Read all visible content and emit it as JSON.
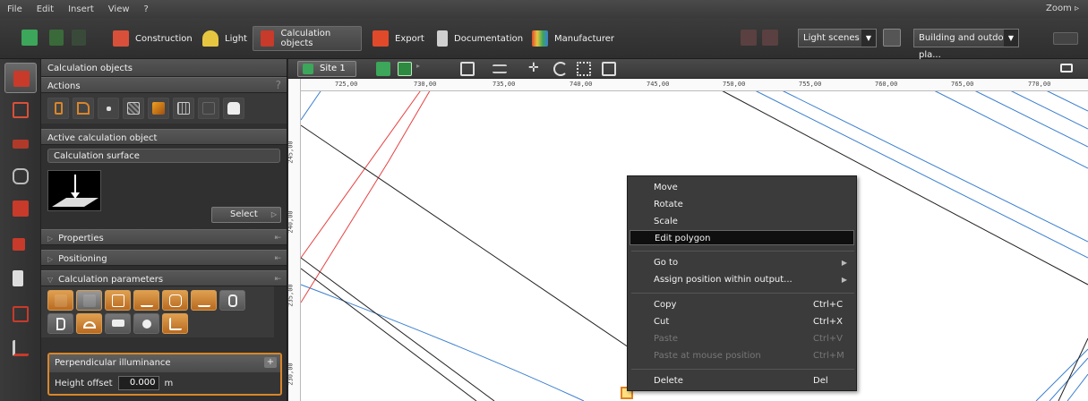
{
  "menu": {
    "items": [
      "File",
      "Edit",
      "Insert",
      "View",
      "?"
    ],
    "zoom_label": "Zoom"
  },
  "toolbar": {
    "tabs": [
      {
        "label": "Construction",
        "icon": "cube-icon"
      },
      {
        "label": "Light",
        "icon": "lamp-icon"
      },
      {
        "label": "Calculation objects",
        "icon": "calc-object-icon"
      },
      {
        "label": "Export",
        "icon": "export-icon"
      },
      {
        "label": "Documentation",
        "icon": "document-icon"
      },
      {
        "label": "Manufacturer",
        "icon": "manufacturer-icon"
      }
    ],
    "light_scene": "Light scenes 1",
    "building_select": "Building and outdoor pla..."
  },
  "panel": {
    "title": "Calculation objects",
    "actions_header": "Actions",
    "help": "?",
    "active_header": "Active calculation object",
    "active_type": "Calculation surface",
    "select_label": "Select",
    "properties_header": "Properties",
    "positioning_header": "Positioning",
    "params_header": "Calculation parameters",
    "illum_title": "Perpendicular illuminance",
    "height_label": "Height offset",
    "height_value": "0.000",
    "height_unit": "m"
  },
  "canvas": {
    "site_tab": "Site 1",
    "ruler_top": [
      "725,00",
      "730,00",
      "735,00",
      "740,00",
      "745,00",
      "750,00",
      "755,00",
      "760,00",
      "765,00",
      "770,00"
    ],
    "ruler_left": [
      "245,00",
      "240,00",
      "235,00",
      "230,00"
    ]
  },
  "context_menu": {
    "move": "Move",
    "rotate": "Rotate",
    "scale": "Scale",
    "edit_polygon": "Edit polygon",
    "go_to": "Go to",
    "assign": "Assign position within output...",
    "copy": "Copy",
    "copy_sc": "Ctrl+C",
    "cut": "Cut",
    "cut_sc": "Ctrl+X",
    "paste": "Paste",
    "paste_sc": "Ctrl+V",
    "paste_mouse": "Paste at mouse position",
    "paste_mouse_sc": "Ctrl+M",
    "delete": "Delete",
    "delete_sc": "Del"
  },
  "colors": {
    "accent_orange": "#d9862a",
    "line_blue": "#3a7fd0",
    "line_red": "#e84040"
  }
}
